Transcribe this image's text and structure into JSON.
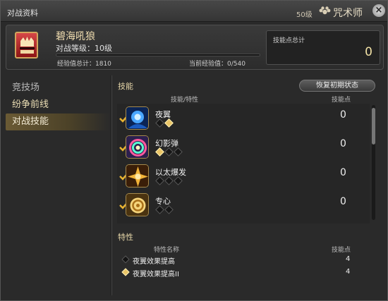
{
  "window": {
    "title": "对战资料",
    "level_tag": "50级",
    "job_name": "咒术师",
    "job_icon": "flower-job-icon",
    "close_icon": "close-icon"
  },
  "header": {
    "emblem_icon": "crimson-wolf-emblem-icon",
    "name": "碧海吼狼",
    "rank": "对战等级：10级",
    "exp_total": "经验值总计：1810",
    "exp_current": "当前经验值：0/540",
    "exp_progress": 0,
    "skill_points_label": "技能点总计",
    "skill_points_value": "0"
  },
  "sidebar": {
    "items": [
      {
        "label": "竞技场",
        "selected": false
      },
      {
        "label": "纷争前线",
        "selected": false
      },
      {
        "label": "对战技能",
        "selected": true
      }
    ]
  },
  "skills": {
    "heading": "技能",
    "reset_button": "恢复初期状态",
    "col_skill": "技能/特性",
    "col_points": "技能点",
    "rows": [
      {
        "name": "夜翼",
        "points": "0",
        "pips_filled": [
          false,
          true
        ],
        "icon": "night-wing-icon"
      },
      {
        "name": "幻影弹",
        "points": "0",
        "pips_filled": [
          true,
          false,
          false
        ],
        "icon": "phantom-dart-icon"
      },
      {
        "name": "以太爆发",
        "points": "0",
        "pips_filled": [
          false,
          false,
          false
        ],
        "icon": "aetherial-burst-icon"
      },
      {
        "name": "专心",
        "points": "0",
        "pips_filled": [
          false,
          false
        ],
        "icon": "focus-icon"
      }
    ]
  },
  "traits": {
    "heading": "特性",
    "col_trait": "特性名称",
    "col_points": "技能点",
    "rows": [
      {
        "name": "夜翼效果提高",
        "points": "4",
        "active": false
      },
      {
        "name": "夜翼效果提高II",
        "points": "4",
        "active": true
      }
    ]
  }
}
